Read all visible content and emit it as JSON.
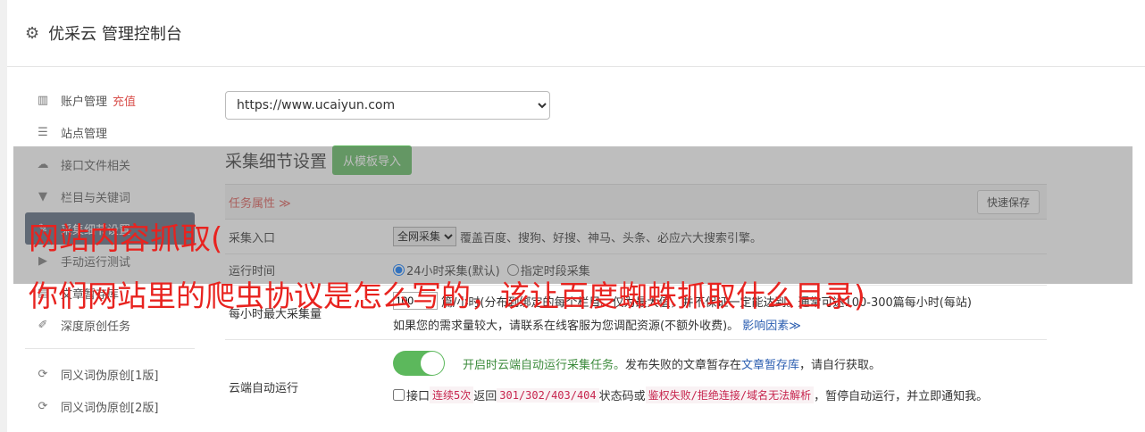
{
  "header": {
    "title": "优采云 管理控制台",
    "icon": "gear-icon"
  },
  "sidebar": {
    "items": [
      {
        "label": "账户管理",
        "badge": "充值",
        "icon": "bar-chart-icon"
      },
      {
        "label": "站点管理",
        "icon": "server-icon"
      },
      {
        "label": "接口文件相关",
        "icon": "cloud-upload-icon"
      },
      {
        "label": "栏目与关键词",
        "icon": "filter-icon"
      },
      {
        "label": "采集细节设置",
        "icon": "wrench-icon"
      },
      {
        "label": "手动运行测试",
        "icon": "play-circle-icon"
      },
      {
        "label": "文章暂存库",
        "icon": "archive-icon"
      },
      {
        "label": "深度原创任务",
        "icon": "edit-icon"
      },
      {
        "label": "同义词伪原创[1版]",
        "icon": "refresh-icon"
      },
      {
        "label": "同义词伪原创[2版]",
        "icon": "refresh-icon"
      }
    ]
  },
  "main": {
    "site_url": "https://www.ucaiyun.com",
    "section_title": "采集细节设置",
    "template_button": "从模板导入",
    "task_attr": "任务属性 ≫",
    "quick_save": "快速保存",
    "rows": {
      "entry": {
        "label": "采集入口",
        "select": "全网采集",
        "desc": "覆盖百度、搜狗、好搜、神马、头条、必应六大搜索引擎。"
      },
      "runtime": {
        "label": "运行时间",
        "opt1": "24小时采集(默认)",
        "opt2": "指定时段采集"
      },
      "max": {
        "label": "每小时最大采集量",
        "value": "100",
        "desc1": "篇/小时(分布到绑定的每个栏目。仅为最大值，并不保证一定能达到。通常可达100-300篇每小时(每站)",
        "desc2": "如果您的需求量较大，请联系在线客服为您调配资源(不额外收费)。",
        "link": "影响因素≫"
      },
      "cloud": {
        "label": "云端自动运行",
        "on_text": "开启时云端自动运行采集任务。",
        "desc_a": "发布失败的文章暂存在",
        "link": "文章暂存库",
        "desc_b": "，请自行获取。",
        "check_a": "接口",
        "code1": "连续5次",
        "check_b": "返回",
        "code2": "301/302/403/404",
        "check_c": "状态码或",
        "code3": "鉴权失败/拒绝连接/域名无法解析",
        "check_d": "，暂停自动运行，并立即通知我。"
      }
    }
  },
  "overlay": {
    "line1": "网站内容抓取(",
    "line2": "你们网站里的爬虫协议是怎么写的，该让百度蜘蛛抓取什么目录)"
  }
}
